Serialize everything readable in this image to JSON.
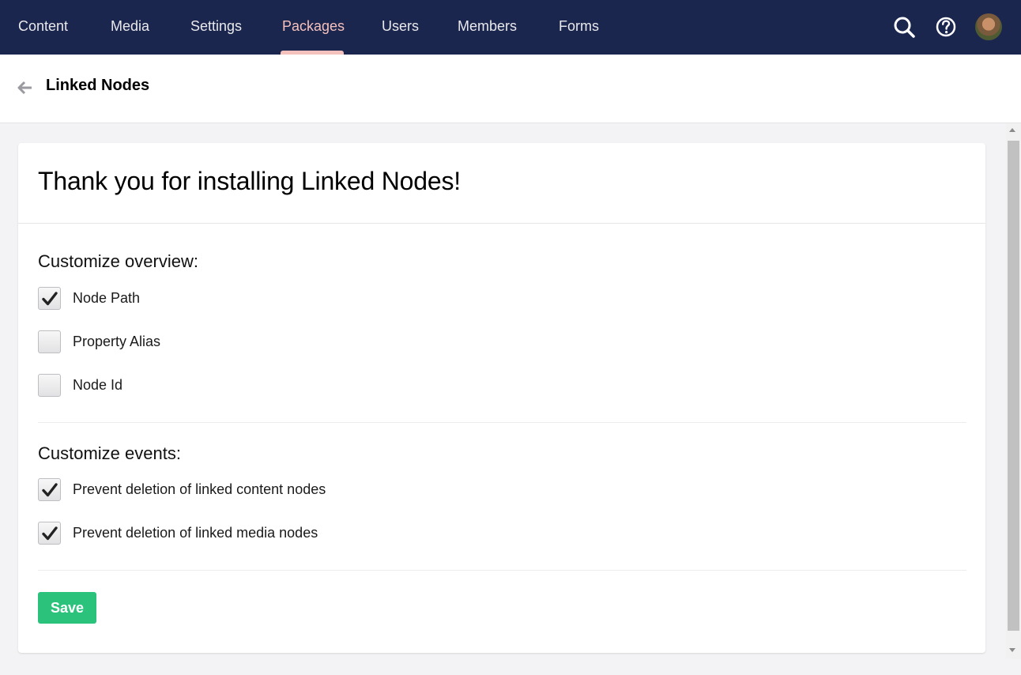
{
  "nav": {
    "items": [
      {
        "label": "Content",
        "active": false
      },
      {
        "label": "Media",
        "active": false
      },
      {
        "label": "Settings",
        "active": false
      },
      {
        "label": "Packages",
        "active": true
      },
      {
        "label": "Users",
        "active": false
      },
      {
        "label": "Members",
        "active": false
      },
      {
        "label": "Forms",
        "active": false
      }
    ],
    "icons": [
      "search-icon",
      "help-icon",
      "avatar"
    ]
  },
  "header": {
    "title": "Linked Nodes"
  },
  "card": {
    "title": "Thank you for installing Linked Nodes!",
    "sections": [
      {
        "title": "Customize overview:",
        "options": [
          {
            "label": "Node Path",
            "checked": true
          },
          {
            "label": "Property Alias",
            "checked": false
          },
          {
            "label": "Node Id",
            "checked": false
          }
        ]
      },
      {
        "title": "Customize events:",
        "options": [
          {
            "label": "Prevent deletion of linked content nodes",
            "checked": true
          },
          {
            "label": "Prevent deletion of linked media nodes",
            "checked": true
          }
        ]
      }
    ],
    "save_label": "Save"
  },
  "colors": {
    "topbar": "#1b264f",
    "active_nav": "#f5c1bc",
    "save_button": "#2bc37c"
  }
}
